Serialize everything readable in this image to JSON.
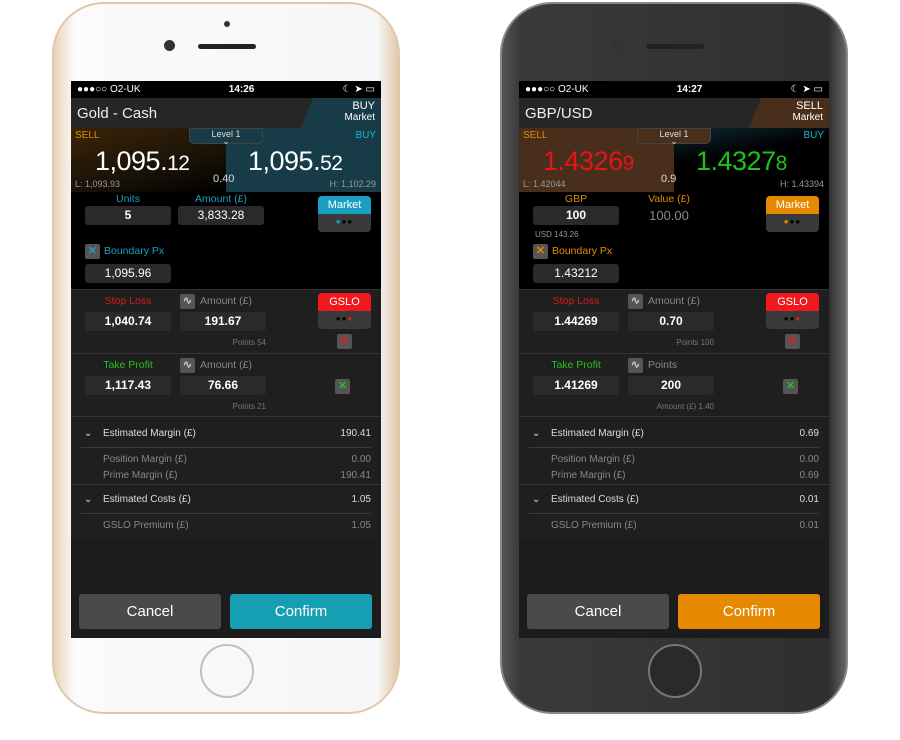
{
  "phones": [
    {
      "theme": "white",
      "accent": "#1b9fc0",
      "confirm_color": "#169fb3",
      "status": {
        "carrier": "●●●○○ O2-UK",
        "time": "14:26",
        "icons": "☾ ➤ ▭"
      },
      "instrument": "Gold - Cash",
      "direction": "BUY",
      "order_type": "Market",
      "side_color": "#173c47",
      "sell_label": "SELL",
      "buy_label": "BUY",
      "level": "Level 1",
      "sell_price_main": "1,095.",
      "sell_price_tail": "12",
      "buy_price_main": "1,095.",
      "buy_price_tail": "52",
      "sell_color": "#ffffff",
      "buy_color": "#ffffff",
      "spread": "0.40",
      "low": "L: 1,093.93",
      "high": "H: 1,102.29",
      "qty_label": "Units",
      "qty_value": "5",
      "amount_label": "Amount (£)",
      "amount_value": "3,833.28",
      "amount_boxed": true,
      "sub_note": "",
      "market_button": "Market",
      "boundary_label": "Boundary Px",
      "boundary_value": "1,095.96",
      "stop_label": "Stop Loss",
      "stop_value": "1,040.74",
      "stop_mode": "Amount (£)",
      "stop_amount": "191.67",
      "stop_note": "Points 54",
      "gslo": "GSLO",
      "tp_label": "Take Profit",
      "tp_value": "1,117.43",
      "tp_mode": "Amount (£)",
      "tp_amount": "76.66",
      "tp_note": "Points 21",
      "margin": {
        "label": "Estimated Margin (£)",
        "value": "190.41",
        "position_label": "Position Margin (£)",
        "position_value": "0.00",
        "prime_label": "Prime Margin (£)",
        "prime_value": "190.41"
      },
      "costs": {
        "label": "Estimated Costs (£)",
        "value": "1.05",
        "gslo_label": "GSLO Premium (£)",
        "gslo_value": "1.05"
      },
      "cancel": "Cancel",
      "confirm": "Confirm"
    },
    {
      "theme": "black",
      "accent": "#e58a00",
      "confirm_color": "#e58a00",
      "status": {
        "carrier": "●●●○○ O2-UK",
        "time": "14:27",
        "icons": "☾ ➤ ▭"
      },
      "instrument": "GBP/USD",
      "direction": "SELL",
      "order_type": "Market",
      "side_color": "#4a2e1c",
      "sell_label": "SELL",
      "buy_label": "BUY",
      "level": "Level 1",
      "sell_price_main": "1.4326",
      "sell_price_tail": "9",
      "buy_price_main": "1.4327",
      "buy_price_tail": "8",
      "sell_color": "#e4141a",
      "buy_color": "#1ec21e",
      "spread": "0.9",
      "low": "L: 1.42044",
      "high": "H: 1.43394",
      "qty_label": "GBP",
      "qty_value": "100",
      "amount_label": "Value (£)",
      "amount_value": "100.00",
      "amount_boxed": false,
      "sub_note": "USD 143.26",
      "market_button": "Market",
      "boundary_label": "Boundary Px",
      "boundary_value": "1.43212",
      "stop_label": "Stop Loss",
      "stop_value": "1.44269",
      "stop_mode": "Amount (£)",
      "stop_amount": "0.70",
      "stop_note": "Points 100",
      "gslo": "GSLO",
      "tp_label": "Take Profit",
      "tp_value": "1.41269",
      "tp_mode": "Points",
      "tp_amount": "200",
      "tp_note": "Amount (£) 1.40",
      "margin": {
        "label": "Estimated Margin (£)",
        "value": "0.69",
        "position_label": "Position Margin (£)",
        "position_value": "0.00",
        "prime_label": "Prime Margin (£)",
        "prime_value": "0.69"
      },
      "costs": {
        "label": "Estimated Costs (£)",
        "value": "0.01",
        "gslo_label": "GSLO Premium (£)",
        "gslo_value": "0.01"
      },
      "cancel": "Cancel",
      "confirm": "Confirm"
    }
  ]
}
